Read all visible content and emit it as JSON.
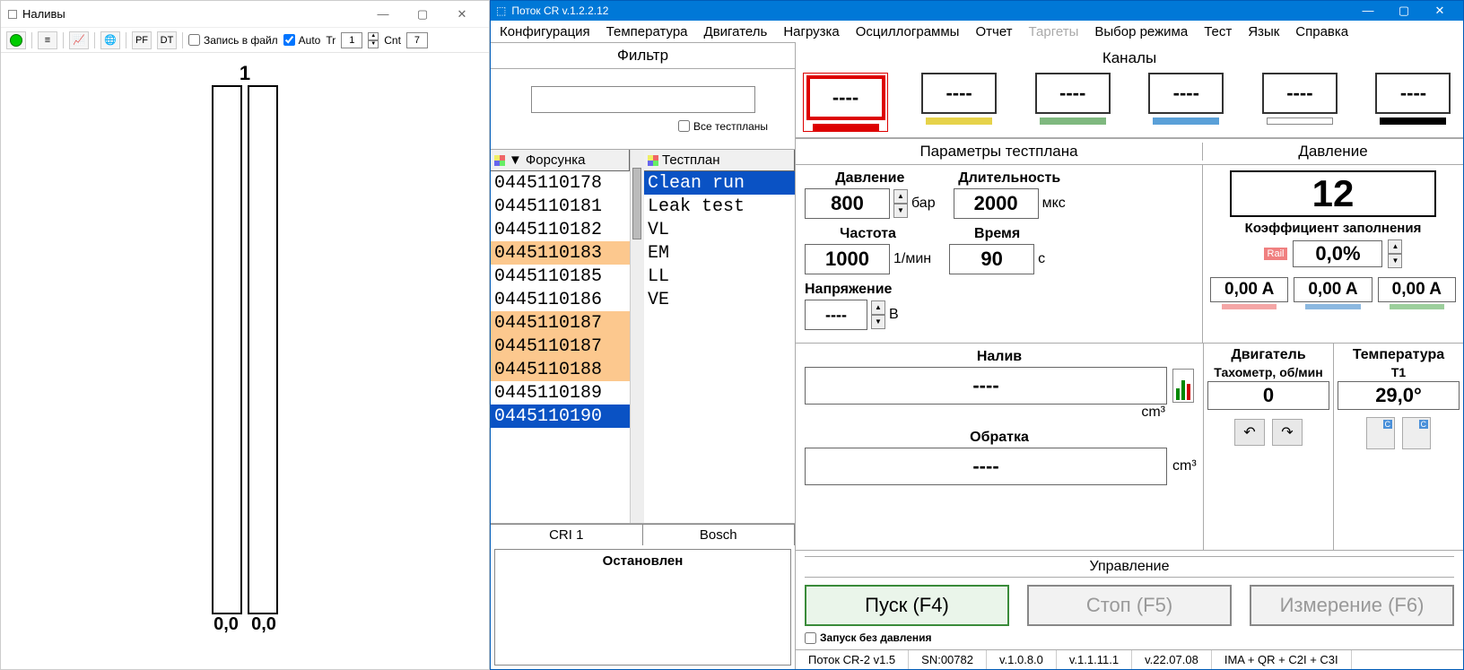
{
  "left": {
    "title": "Наливы",
    "toolbar": {
      "pf": "PF",
      "dt": "DT",
      "record_label": "Запись в файл",
      "record_checked": false,
      "auto_label": "Auto",
      "auto_checked": true,
      "tr_label": "Tr",
      "tr_value": "1",
      "cnt_label": "Cnt",
      "cnt_value": "7"
    },
    "vessel": {
      "num": "1",
      "v1": "0,0",
      "v2": "0,0"
    }
  },
  "right": {
    "title": "Поток CR v.1.2.2.12",
    "menu": [
      "Конфигурация",
      "Температура",
      "Двигатель",
      "Нагрузка",
      "Осциллограммы",
      "Отчет",
      "Таргеты",
      "Выбор режима",
      "Тест",
      "Язык",
      "Справка"
    ],
    "menu_disabled_index": 6,
    "filter": {
      "title": "Фильтр",
      "value": "",
      "all_testplans_label": "Все тестпланы",
      "all_testplans_checked": false
    },
    "injector_header": "Форсунка",
    "testplan_header": "Тестплан",
    "injectors": [
      {
        "v": "0445110178",
        "o": false
      },
      {
        "v": "0445110181",
        "o": false
      },
      {
        "v": "0445110182",
        "o": false
      },
      {
        "v": "0445110183",
        "o": true
      },
      {
        "v": "0445110185",
        "o": false
      },
      {
        "v": "0445110186",
        "o": false
      },
      {
        "v": "0445110187",
        "o": true
      },
      {
        "v": "0445110187",
        "o": true
      },
      {
        "v": "0445110188",
        "o": true
      },
      {
        "v": "0445110189",
        "o": false
      },
      {
        "v": "0445110190",
        "o": false,
        "sel": true
      }
    ],
    "testplans": [
      "Clean run",
      "Leak test",
      "VL",
      "EM",
      "LL",
      "VE"
    ],
    "testplan_selected_index": 0,
    "footer_left": "CRI 1",
    "footer_right": "Bosch",
    "status": "Остановлен",
    "channels": {
      "title": "Каналы",
      "items": [
        {
          "v": "----",
          "bar": "#d00",
          "sel": true
        },
        {
          "v": "----",
          "bar": "#e6d24a",
          "sel": false
        },
        {
          "v": "----",
          "bar": "#7fb87f",
          "sel": false
        },
        {
          "v": "----",
          "bar": "#5aa0d8",
          "sel": false
        },
        {
          "v": "----",
          "bar": "#ffffff",
          "sel": false
        },
        {
          "v": "----",
          "bar": "#000000",
          "sel": false
        }
      ]
    },
    "params": {
      "title": "Параметры тестплана",
      "pressure_label": "Давление",
      "pressure": "800",
      "pressure_unit": "бар",
      "duration_label": "Длительность",
      "duration": "2000",
      "duration_unit": "мкс",
      "freq_label": "Частота",
      "freq": "1000",
      "freq_unit": "1/мин",
      "time_label": "Время",
      "time": "90",
      "time_unit": "с",
      "voltage_label": "Напряжение",
      "voltage": "----",
      "voltage_unit": "В"
    },
    "pressure_panel": {
      "title": "Давление",
      "value": "12",
      "duty_label": "Коэффициент заполнения",
      "rail_badge": "Rail",
      "duty_value": "0,0%",
      "amps": [
        {
          "v": "0,00 A",
          "bar": "#f4a6a6"
        },
        {
          "v": "0,00 A",
          "bar": "#8cb8e0"
        },
        {
          "v": "0,00 A",
          "bar": "#9ccf9c"
        }
      ]
    },
    "naliv": {
      "label": "Налив",
      "value": "----",
      "unit": "cm³",
      "obr_label": "Обратка",
      "obr_value": "----",
      "obr_unit": "cm³"
    },
    "engine": {
      "title": "Двигатель",
      "tacho_label": "Тахометр, об/мин",
      "tacho_value": "0"
    },
    "temp": {
      "title": "Температура",
      "t1_label": "T1",
      "t1_value": "29,0°"
    },
    "control": {
      "title": "Управление",
      "start": "Пуск (F4)",
      "stop": "Стоп (F5)",
      "measure": "Измерение (F6)",
      "nopress_label": "Запуск без давления",
      "nopress_checked": false
    },
    "statusbar": [
      "Поток CR-2 v1.5",
      "SN:00782",
      "v.1.0.8.0",
      "v.1.1.11.1",
      "v.22.07.08",
      "IMA + QR + C2I + C3I"
    ]
  }
}
